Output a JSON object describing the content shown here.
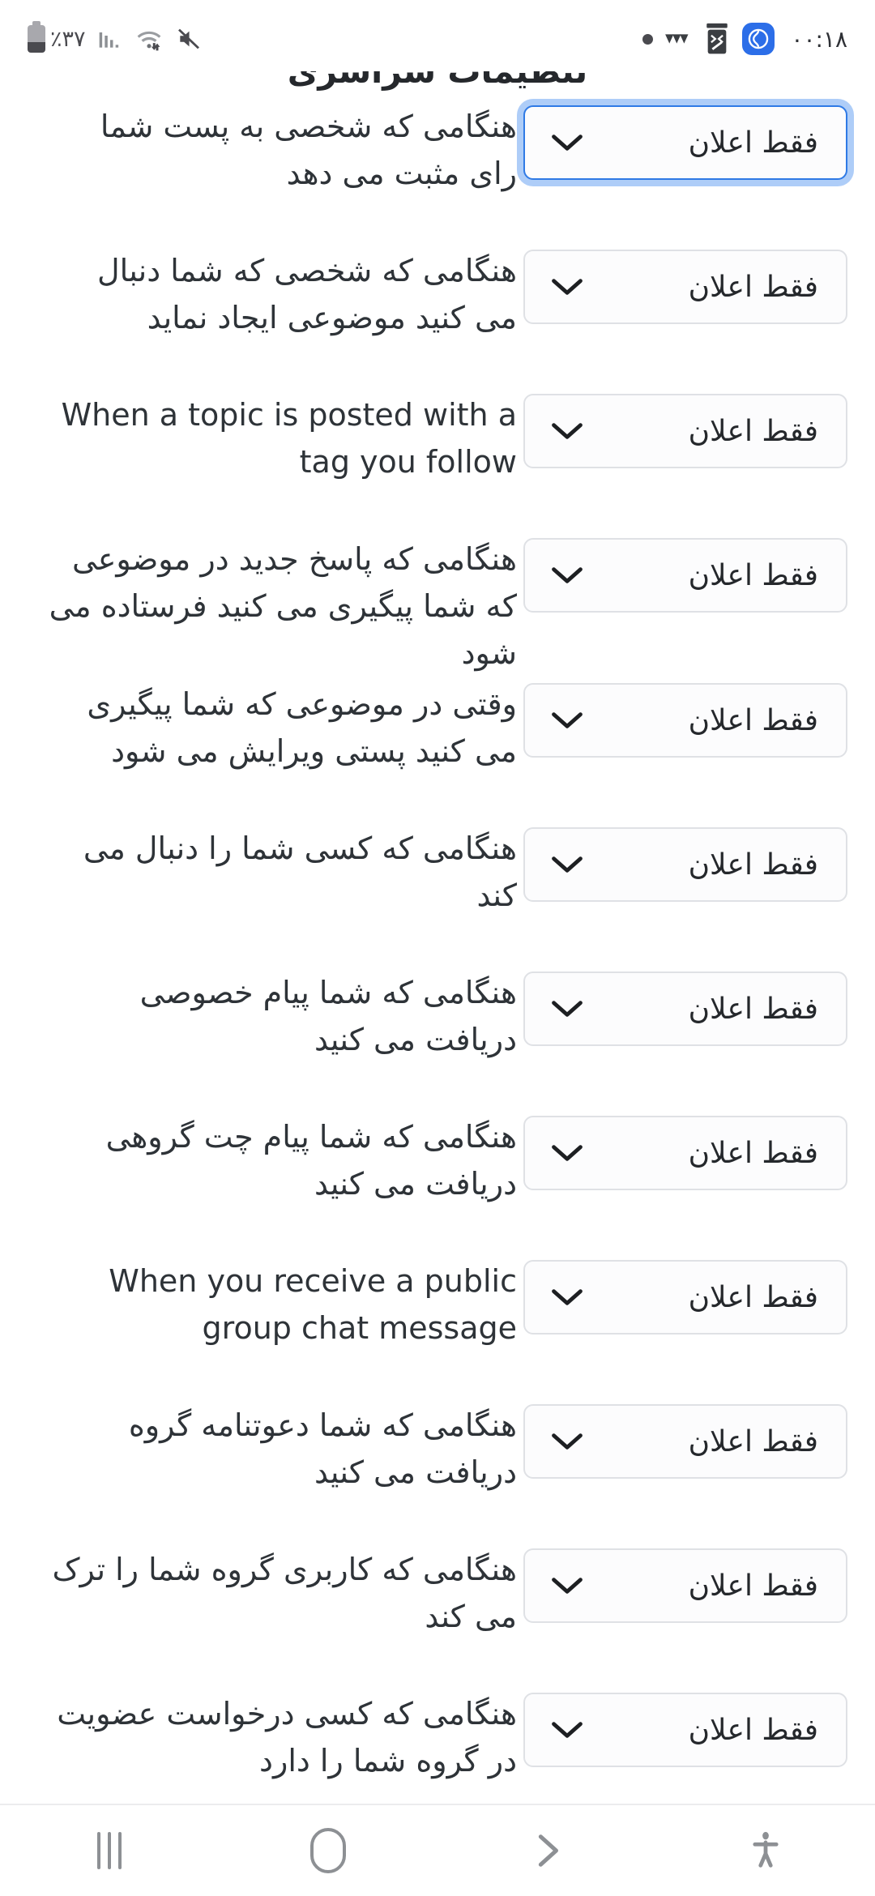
{
  "statusbar": {
    "battery_percent": "٪٣٧",
    "time": "٠٠:١٨",
    "icons": {
      "battery": "battery-icon",
      "signal": "cellular-signal-icon",
      "wifi": "wifi-icon",
      "mute": "volume-mute-icon",
      "dot": "recording-dot-icon",
      "vibrate": "vibrate-icon",
      "coffee": "coffee-app-icon",
      "app": "messenger-app-icon"
    }
  },
  "header": {
    "title": "تنظیمات سراسری"
  },
  "select_default_value": "فقط اعلان",
  "rows": [
    {
      "label": "هنگامی که شخصی به پست شما رای مثبت می دهد",
      "dir": "rtl",
      "value": "فقط اعلان",
      "focused": true
    },
    {
      "label": "هنگامی که شخصی که شما دنبال می کنید موضوعی ایجاد نماید",
      "dir": "rtl",
      "value": "فقط اعلان",
      "focused": false
    },
    {
      "label": "When a topic is posted with a tag you follow",
      "dir": "ltr",
      "value": "فقط اعلان",
      "focused": false
    },
    {
      "label": "هنگامی که پاسخ جدید در موضوعی که شما پیگیری می کنید فرستاده می شود",
      "dir": "rtl",
      "value": "فقط اعلان",
      "focused": false
    },
    {
      "label": "وقتی در موضوعی که شما پیگیری می کنید پستی ویرایش می شود",
      "dir": "rtl",
      "value": "فقط اعلان",
      "focused": false
    },
    {
      "label": "هنگامی که کسی شما را دنبال می کند",
      "dir": "rtl",
      "value": "فقط اعلان",
      "focused": false
    },
    {
      "label": "هنگامی که شما پیام خصوصی دریافت می کنید",
      "dir": "rtl",
      "value": "فقط اعلان",
      "focused": false
    },
    {
      "label": "هنگامی که شما پیام چت گروهی دریافت می کنید",
      "dir": "rtl",
      "value": "فقط اعلان",
      "focused": false
    },
    {
      "label": "When you receive a public group chat message",
      "dir": "ltr",
      "value": "فقط اعلان",
      "focused": false
    },
    {
      "label": "هنگامی که شما دعوتنامه گروه دریافت می کنید",
      "dir": "rtl",
      "value": "فقط اعلان",
      "focused": false
    },
    {
      "label": "هنگامی که کاربری گروه شما را ترک می کند",
      "dir": "rtl",
      "value": "فقط اعلان",
      "focused": false
    },
    {
      "label": "هنگامی که کسی درخواست عضویت در گروه شما را دارد",
      "dir": "rtl",
      "value": "فقط اعلان",
      "focused": false
    }
  ],
  "navbar": {
    "recents_label": "recent-apps",
    "home_label": "home",
    "back_label": "back",
    "accessibility_label": "accessibility"
  },
  "colors": {
    "accent": "#2f7ae5",
    "focus_ring": "#7caef3",
    "text": "#2e3338",
    "border": "#dfe1e5",
    "nav_icon": "#8d9094",
    "app_badge": "#2c6ee8"
  }
}
